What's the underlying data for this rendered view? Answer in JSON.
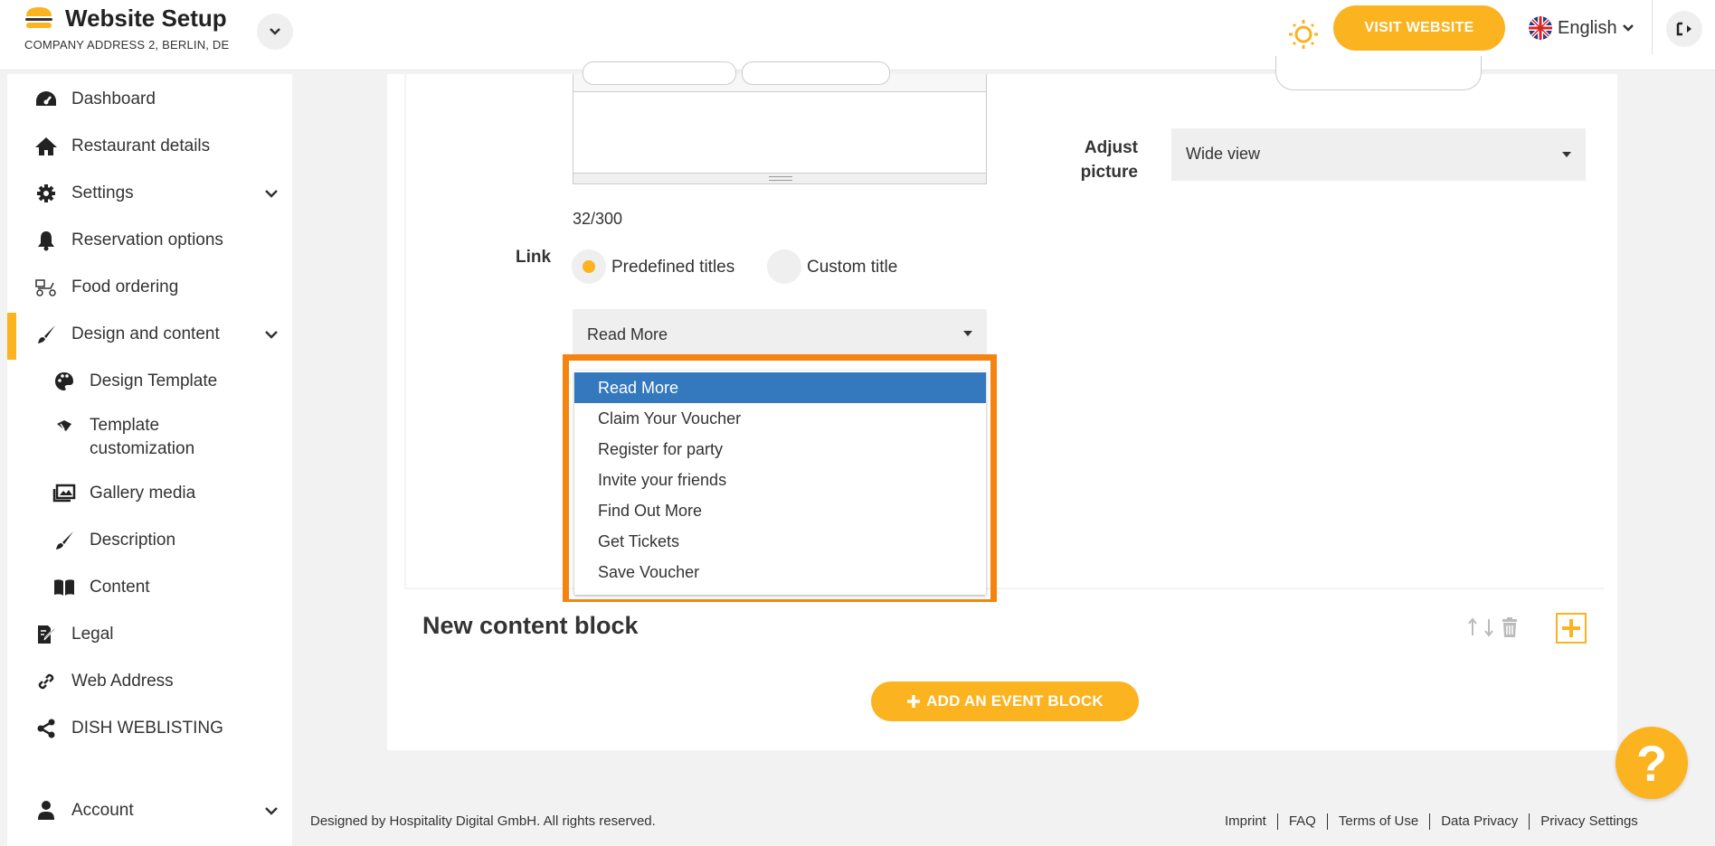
{
  "header": {
    "title": "Website Setup",
    "subtitle": "COMPANY ADDRESS 2, BERLIN, DE",
    "visit_label": "VISIT WEBSITE",
    "language": "English"
  },
  "sidebar": {
    "items": [
      {
        "label": "Dashboard",
        "icon": "dashboard-icon"
      },
      {
        "label": "Restaurant details",
        "icon": "home-icon"
      },
      {
        "label": "Settings",
        "icon": "gear-icon"
      },
      {
        "label": "Reservation options",
        "icon": "bell-icon"
      },
      {
        "label": "Food ordering",
        "icon": "scooter-icon"
      },
      {
        "label": "Design and content",
        "icon": "brush-icon"
      },
      {
        "label": "Design Template",
        "icon": "palette-icon"
      },
      {
        "label": "Template customization",
        "icon": "palette-icon"
      },
      {
        "label": "Gallery media",
        "icon": "gallery-icon"
      },
      {
        "label": "Description",
        "icon": "brush-icon"
      },
      {
        "label": "Content",
        "icon": "book-icon"
      },
      {
        "label": "Legal",
        "icon": "document-icon"
      },
      {
        "label": "Web Address",
        "icon": "link-icon"
      },
      {
        "label": "DISH WEBLISTING",
        "icon": "share-icon"
      },
      {
        "label": "Account",
        "icon": "user-icon"
      }
    ]
  },
  "form": {
    "counter": "32/300",
    "link_label": "Link",
    "radio_predefined": "Predefined titles",
    "radio_custom": "Custom title",
    "selected_title": "Read More",
    "options": [
      "Read More",
      "Claim Your Voucher",
      "Register for party",
      "Invite your friends",
      "Find Out More",
      "Get Tickets",
      "Save Voucher"
    ],
    "adjust_label": "Adjust picture",
    "adjust_value": "Wide view"
  },
  "block": {
    "title": "New content block"
  },
  "add_event_label": "ADD AN EVENT BLOCK",
  "help_label": "?",
  "footer": {
    "credit": "Designed by Hospitality Digital GmbH. All rights reserved.",
    "links": [
      "Imprint",
      "FAQ",
      "Terms of Use",
      "Data Privacy",
      "Privacy Settings"
    ]
  },
  "colors": {
    "accent": "#fbb31f",
    "highlight": "#f5840f",
    "selected_option": "#3478bd"
  }
}
